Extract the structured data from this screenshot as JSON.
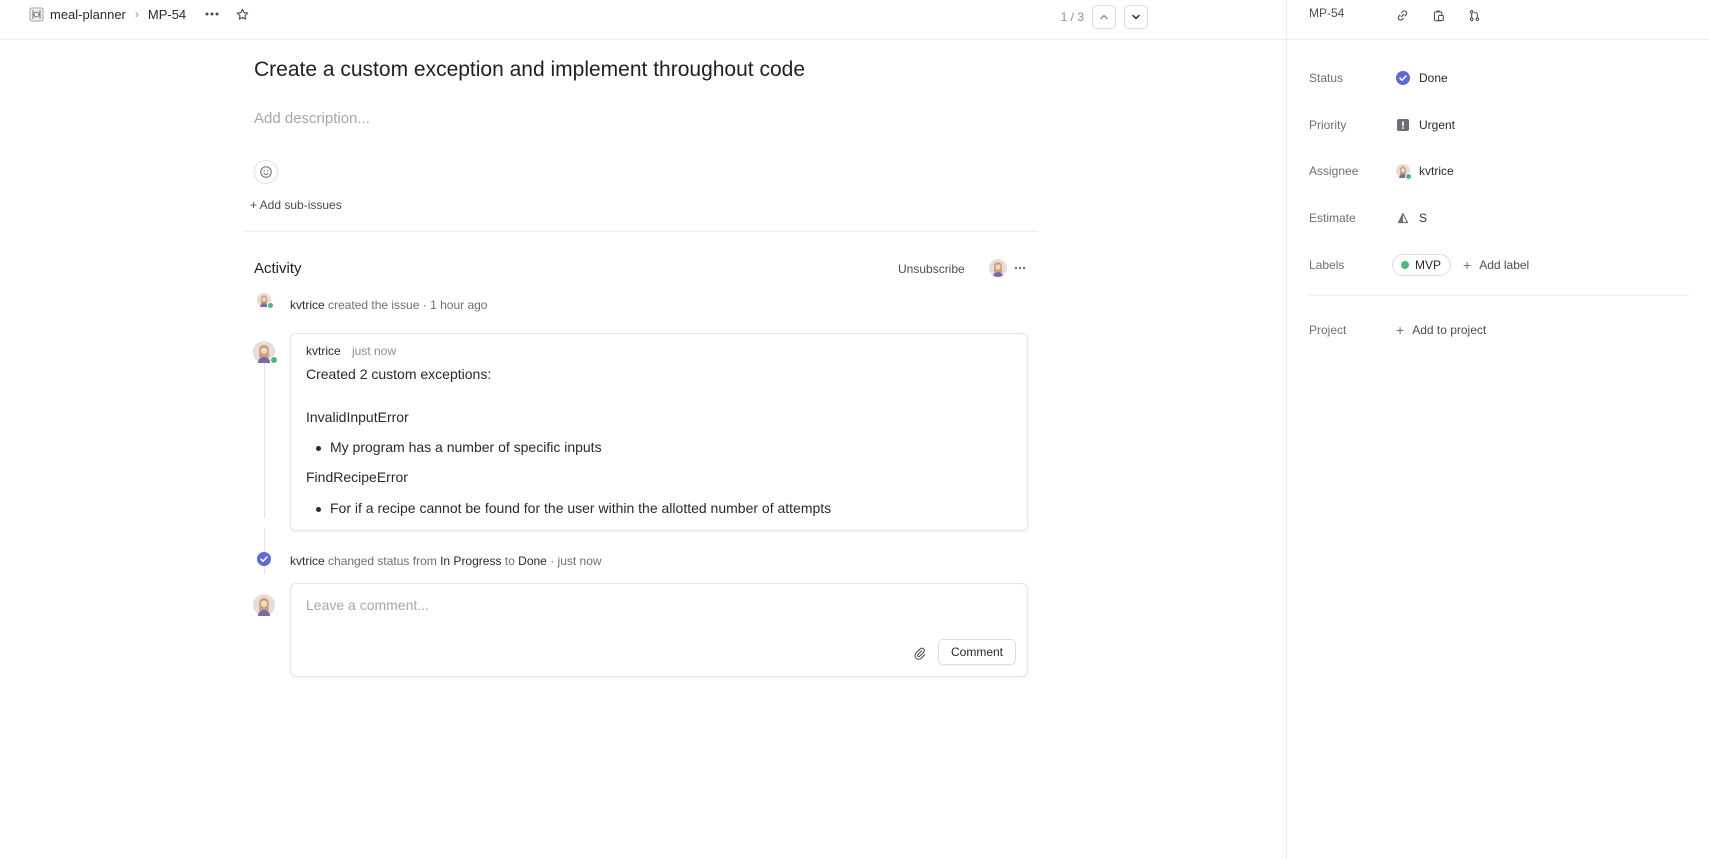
{
  "breadcrumb": {
    "project": "meal-planner",
    "separator": "›",
    "issue_id": "MP-54"
  },
  "pager": {
    "text": "1 / 3"
  },
  "issue": {
    "title": "Create a custom exception and implement throughout code",
    "description_placeholder": "Add description...",
    "add_sub_issues": "+ Add sub-issues"
  },
  "activity": {
    "title": "Activity",
    "unsubscribe": "Unsubscribe",
    "created_event": {
      "user": "kvtrice",
      "action": "created the issue",
      "dot": "·",
      "time": "1 hour ago"
    },
    "comment": {
      "author": "kvtrice",
      "time": "just now",
      "intro": "Created 2 custom exceptions:",
      "exceptions": [
        {
          "name": "InvalidInputError",
          "detail": "My program has a number of specific inputs"
        },
        {
          "name": "FindRecipeError",
          "detail": "For if a recipe cannot be found for the user within the allotted number of attempts"
        }
      ]
    },
    "status_event": {
      "user": "kvtrice",
      "action": "changed status from",
      "from": "In Progress",
      "to_word": "to",
      "to": "Done",
      "dot": "·",
      "time": "just now"
    },
    "compose": {
      "placeholder": "Leave a comment...",
      "button": "Comment"
    }
  },
  "side": {
    "issue_id": "MP-54",
    "properties": {
      "status": {
        "label": "Status",
        "value": "Done",
        "color": "#5e6ad2"
      },
      "priority": {
        "label": "Priority",
        "value": "Urgent",
        "icon_color": "#6b6f76"
      },
      "assignee": {
        "label": "Assignee",
        "value": "kvtrice"
      },
      "estimate": {
        "label": "Estimate",
        "value": "S"
      },
      "labels": {
        "label": "Labels",
        "value": "MVP",
        "color": "#4cb782",
        "add": "Add label"
      },
      "project": {
        "label": "Project",
        "add": "Add to project"
      }
    }
  },
  "colors": {
    "accent": "#5e6ad2",
    "online": "#4cb782",
    "border": "#e3e4e8"
  }
}
